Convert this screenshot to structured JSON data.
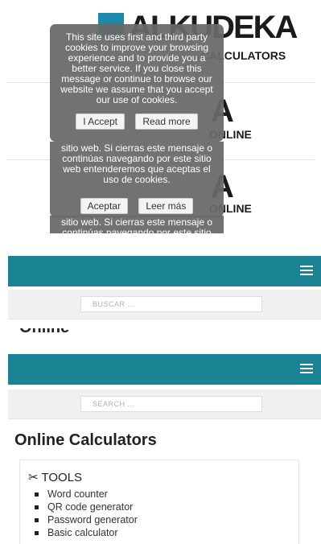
{
  "logos": [
    {
      "title": "ALKUDEKA",
      "subtitle": "CALCULATORS"
    },
    {
      "title": "A",
      "subtitle": "ONLINE"
    },
    {
      "title": "A",
      "subtitle": "ONLINE"
    }
  ],
  "cookie_en": {
    "message": "This site uses first and third party cookies to improve your browsing experience and to provide you a better service. If you close this message or continue to browse our website we assume that you accept our use of cookies.",
    "accept": "I Accept",
    "more": "Read more"
  },
  "cookie_es": {
    "message": "sitio web. Si cierras este mensaje o continúas navegando por este sitio web entenderemos que aceptas el uso de cookies.",
    "accept": "Aceptar",
    "more": "Leer más"
  },
  "cookie_es_partial": {
    "message": "sitio web. Si cierras este mensaje o continúas navegando por este sitio"
  },
  "header_es": {
    "search_placeholder": "BUSCAR ..."
  },
  "header_en": {
    "search_placeholder": "SEARCH ..."
  },
  "page_title": "Online Calculators",
  "tools": {
    "heading": "TOOLS",
    "items": [
      "Word counter",
      "QR code generator",
      "Password generator",
      "Basic calculator"
    ]
  },
  "colors": {
    "teal": "#1a8394",
    "cookie_bg": "#696969"
  }
}
